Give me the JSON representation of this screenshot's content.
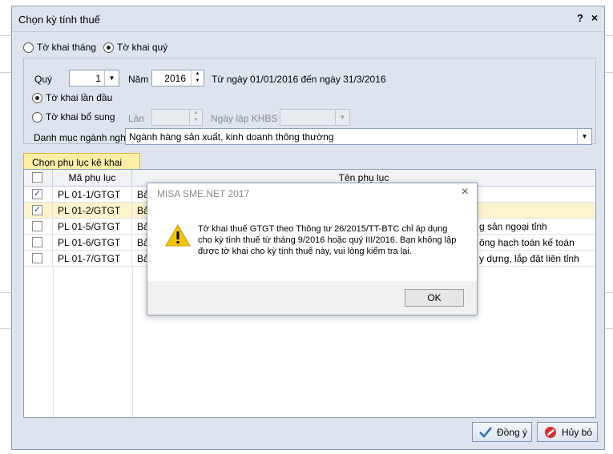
{
  "dialog": {
    "title": "Chọn kỳ tính thuế",
    "help": "?",
    "close": "×"
  },
  "period_type": {
    "monthly_label": "Tờ khai tháng",
    "quarterly_label": "Tờ khai quý",
    "selected": "quarterly"
  },
  "period": {
    "quarter_label": "Quý",
    "quarter_value": "1",
    "year_label": "Năm",
    "year_value": "2016",
    "range_text": "Từ ngày 01/01/2016 đến ngày 31/3/2016"
  },
  "declaration": {
    "first_label": "Tờ khai lần đầu",
    "supplement_label": "Tờ khai bổ sung",
    "selected": "first",
    "times_label": "Lần",
    "khbs_date_label": "Ngày lập KHBS"
  },
  "industry": {
    "label": "Danh mục ngành nghề",
    "value": "Ngành hàng sản xuất, kinh doanh thông thường"
  },
  "tab": {
    "label": "Chọn phụ lục kê khai"
  },
  "grid": {
    "columns": [
      "Mã phụ lục",
      "Tên phụ lục"
    ],
    "rows": [
      {
        "checked": true,
        "code": "PL 01-1/GTGT",
        "name": "Bả"
      },
      {
        "checked": true,
        "code": "PL 01-2/GTGT",
        "name": "Bả"
      },
      {
        "checked": false,
        "code": "PL 01-5/GTGT",
        "name": "Bả",
        "name_tail": "g sản ngoại tỉnh"
      },
      {
        "checked": false,
        "code": "PL 01-6/GTGT",
        "name": "Bả",
        "name_tail": "ông hạch toán kế toán"
      },
      {
        "checked": false,
        "code": "PL 01-7/GTGT",
        "name": "Bả",
        "name_tail": "y dựng, lắp đặt liên tỉnh"
      }
    ]
  },
  "buttons": {
    "ok_label": "Đồng ý",
    "cancel_label": "Hủy bỏ"
  },
  "message_box": {
    "title": "MISA SME.NET 2017",
    "close": "×",
    "text": "Tờ khai thuế GTGT theo Thông tư 26/2015/TT-BTC chỉ áp dụng cho kỳ tính thuế từ tháng 9/2016 hoặc quý III/2016. Bạn không lập được tờ khai cho kỳ tính thuế này, vui lòng kiểm tra lại.",
    "ok_label": "OK"
  },
  "colors": {
    "dialog_bg": "#dde4ee",
    "tab_bg": "#fdeea6",
    "selected_row": "#fdf3cc",
    "warning": "#f5c400"
  }
}
